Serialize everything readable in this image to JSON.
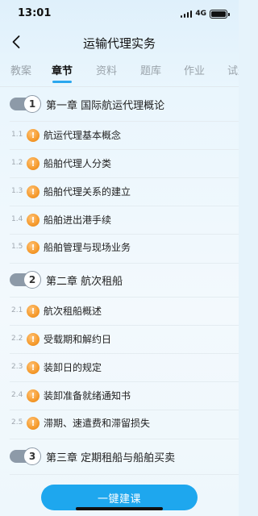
{
  "status_bar": {
    "time": "13:01",
    "network": "4G"
  },
  "header": {
    "title": "运输代理实务"
  },
  "tabs": [
    {
      "label": "教案"
    },
    {
      "label": "章节"
    },
    {
      "label": "资料"
    },
    {
      "label": "题库"
    },
    {
      "label": "作业"
    },
    {
      "label": "试题"
    }
  ],
  "active_tab": "章节",
  "chapters": [
    {
      "number": "1",
      "title": "第一章 国际航运代理概论",
      "sections": [
        {
          "num": "1.1",
          "label": "航运代理基本概念"
        },
        {
          "num": "1.2",
          "label": "船舶代理人分类"
        },
        {
          "num": "1.3",
          "label": "船舶代理关系的建立"
        },
        {
          "num": "1.4",
          "label": "船舶进出港手续"
        },
        {
          "num": "1.5",
          "label": "船舶管理与现场业务"
        }
      ]
    },
    {
      "number": "2",
      "title": "第二章 航次租船",
      "sections": [
        {
          "num": "2.1",
          "label": "航次租船概述"
        },
        {
          "num": "2.2",
          "label": "受载期和解约日"
        },
        {
          "num": "2.3",
          "label": "装卸日的规定"
        },
        {
          "num": "2.4",
          "label": "装卸准备就绪通知书"
        },
        {
          "num": "2.5",
          "label": "滞期、速遣费和滞留损失"
        }
      ]
    },
    {
      "number": "3",
      "title": "第三章 定期租船与船舶买卖",
      "sections": []
    }
  ],
  "section_badge": "!",
  "cta": {
    "label": "一键建课"
  },
  "colors": {
    "accent": "#1ea7ee",
    "badge": "#f59a2c",
    "toggle": "#8d9aa8"
  },
  "icons": [
    "signal-icon",
    "battery-icon",
    "back-chevron-icon",
    "chapter-toggle-icon",
    "section-badge-icon"
  ]
}
